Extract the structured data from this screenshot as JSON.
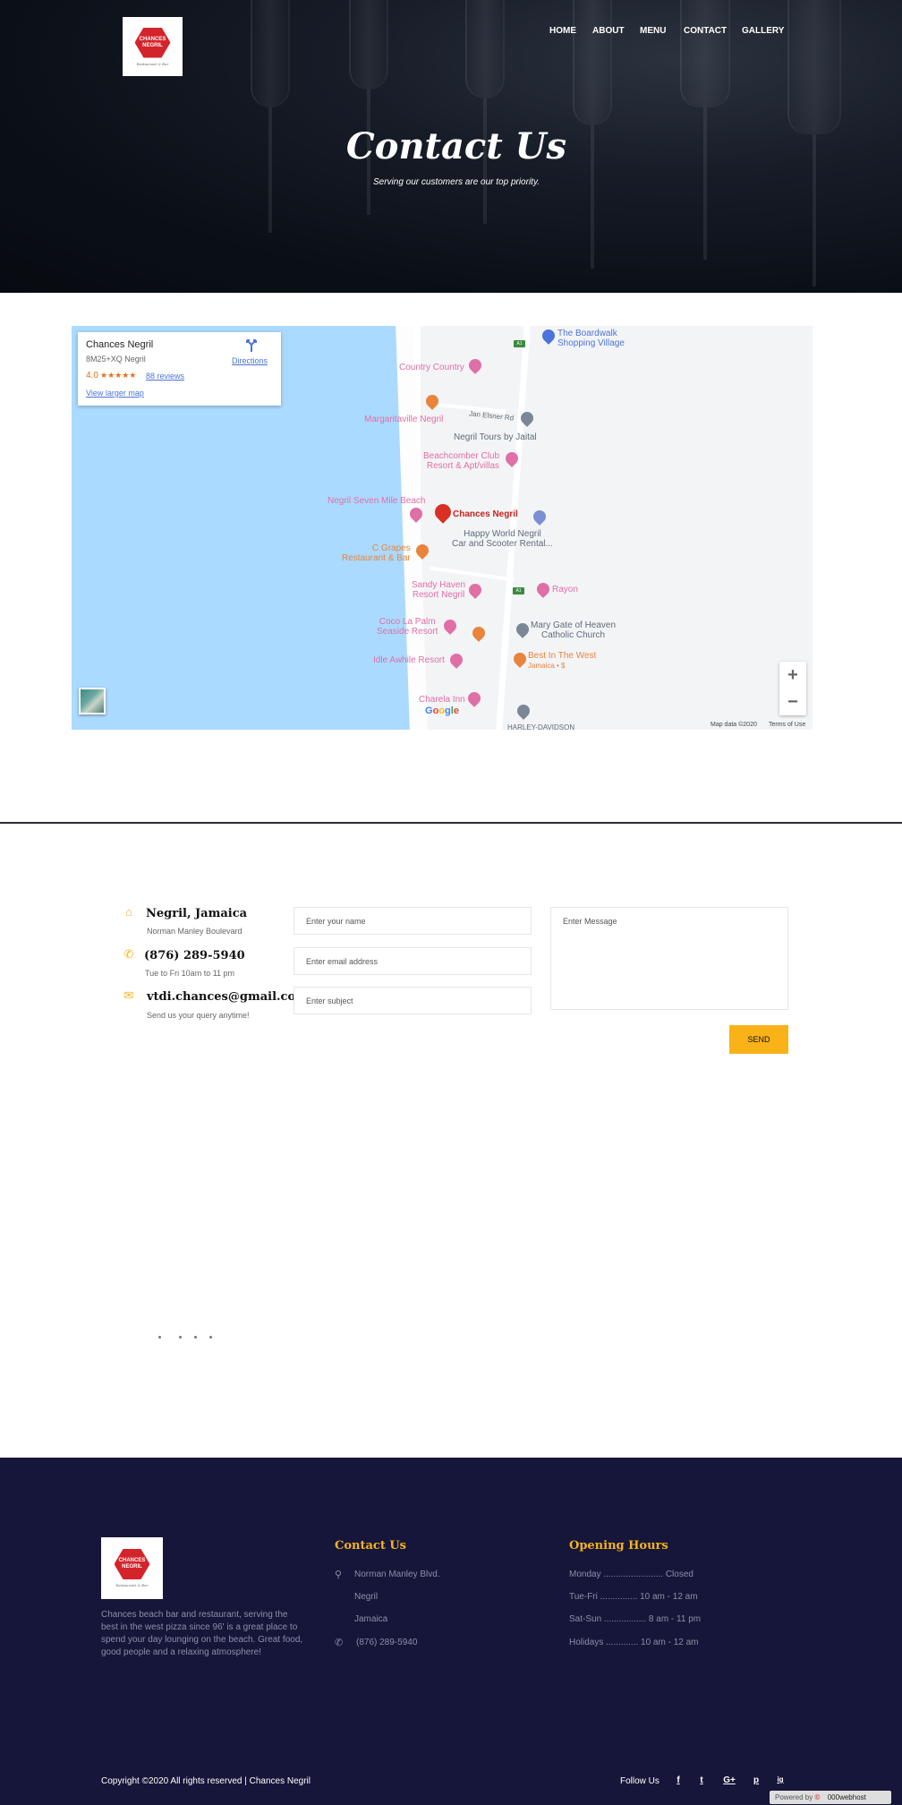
{
  "brand": {
    "logo_text": "CHANCES NEGRIL",
    "logo_tagline": "Restaurant & Bar"
  },
  "nav": {
    "items": [
      "HOME",
      "ABOUT",
      "MENU",
      "CONTACT",
      "GALLERY"
    ]
  },
  "hero": {
    "title": "Contact Us",
    "subtitle": "Serving our customers are our top priority."
  },
  "map": {
    "card": {
      "name": "Chances Negril",
      "plus_code": "8M25+XQ Negril",
      "rating": "4.0",
      "stars": "★★★★★",
      "reviews": "88 reviews",
      "larger_map": "View larger map",
      "directions": "Directions"
    },
    "places": {
      "boardwalk": "The Boardwalk\nShopping Village",
      "country": "Country Country",
      "margaritaville": "Margaritaville Negril",
      "jan_elsner": "Jan Elsner Rd",
      "tours": "Negril Tours by Jaital",
      "beachcomber": "Beachcomber Club\nResort & Apt/villas",
      "seven_mile": "Negril Seven Mile Beach",
      "chances": "Chances Negril",
      "happy_world": "Happy World Negril\nCar and Scooter Rental...",
      "grapes": "C Grapes\nRestaurant & Bar",
      "sandy_haven": "Sandy Haven\nResort Negril",
      "rayon": "Rayon",
      "coco": "Coco La Palm\nSeaside Resort",
      "mary_gate": "Mary Gate of Heaven\nCatholic Church",
      "best_west": "Best In The West",
      "jamaica_price": "Jamaica • $",
      "idle": "Idle Awhile Resort",
      "charela": "Charela Inn",
      "harley": "HARLEY-DAVIDSON",
      "route": "A1"
    },
    "zoom_in": "+",
    "zoom_out": "−",
    "google": "Google",
    "map_data": "Map data ©2020",
    "terms": "Terms of Use"
  },
  "contact_info": [
    {
      "icon": "home-icon",
      "title": "Negril, Jamaica",
      "sub": "Norman Manley Boulevard"
    },
    {
      "icon": "phone-icon",
      "title": "(876) 289-5940",
      "sub": "Tue to Fri 10am to 11 pm"
    },
    {
      "icon": "mail-icon",
      "title": "vtdi.chances@gmail.com",
      "sub": "Send us your query anytime!"
    }
  ],
  "form": {
    "name_placeholder": "Enter your name",
    "email_placeholder": "Enter email address",
    "subject_placeholder": "Enter subject",
    "message_placeholder": "Enter Message",
    "send_label": "SEND"
  },
  "footer": {
    "about": "Chances beach bar and restaurant, serving the best in the west pizza since 96' is a great place to spend your day lounging on the beach. Great food, good people and a relaxing atmosphere!",
    "contact_title": "Contact Us",
    "address_1": "Norman Manley Blvd.",
    "address_2": "Negril",
    "address_3": "Jamaica",
    "phone": "(876) 289-5940",
    "hours_title": "Opening Hours",
    "hours": [
      "Monday ........................ Closed",
      "Tue-Fri ............... 10 am - 12 am",
      "Sat-Sun ................. 8 am - 11 pm",
      "Holidays ............. 10 am - 12 am"
    ],
    "copyright": "Copyright ©2020 All rights reserved | Chances Negril",
    "follow": "Follow Us",
    "social": [
      "f",
      "t",
      "G+",
      "p",
      "ig"
    ],
    "powered": "Powered by",
    "host": "000webhost"
  },
  "colors": {
    "accent": "#f9b218",
    "footer_bg": "#16163a",
    "logo_red": "#d3242b"
  }
}
